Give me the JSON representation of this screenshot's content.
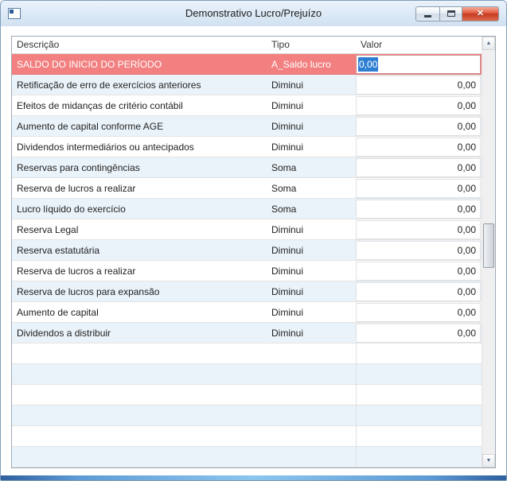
{
  "window": {
    "title": "Demonstrativo Lucro/Prejuízo"
  },
  "icons": {
    "close": "✕",
    "scroll_up": "▲",
    "scroll_down": "▼"
  },
  "colors": {
    "selected_row_bg": "#f28080",
    "selection_bg": "#2e7fd3",
    "alt_row_bg": "#eaf3fa",
    "window_border": "#7f9db9"
  },
  "table": {
    "columns": [
      "Descrição",
      "Tipo",
      "Valor"
    ],
    "empty_row_count": 6,
    "rows": [
      {
        "descricao": "SALDO DO INICIO DO PERÍODO",
        "tipo": "A_Saldo lucro",
        "valor": "0,00",
        "selected": true
      },
      {
        "descricao": "Retificação de erro de exercícios anteriores",
        "tipo": "Diminui",
        "valor": "0,00"
      },
      {
        "descricao": "Efeitos de midanças de critério contábil",
        "tipo": "Diminui",
        "valor": "0,00"
      },
      {
        "descricao": "Aumento de capital conforme AGE",
        "tipo": "Diminui",
        "valor": "0,00"
      },
      {
        "descricao": "Dividendos intermediários ou antecipados",
        "tipo": "Diminui",
        "valor": "0,00"
      },
      {
        "descricao": "Reservas para contingências",
        "tipo": "Soma",
        "valor": "0,00"
      },
      {
        "descricao": "Reserva de lucros a realizar",
        "tipo": "Soma",
        "valor": "0,00"
      },
      {
        "descricao": "Lucro líquido do exercício",
        "tipo": "Soma",
        "valor": "0,00"
      },
      {
        "descricao": "Reserva Legal",
        "tipo": "Diminui",
        "valor": "0,00"
      },
      {
        "descricao": "Reserva estatutária",
        "tipo": "Diminui",
        "valor": "0,00"
      },
      {
        "descricao": "Reserva de lucros a realizar",
        "tipo": "Diminui",
        "valor": "0,00"
      },
      {
        "descricao": "Reserva de lucros para expansão",
        "tipo": "Diminui",
        "valor": "0,00"
      },
      {
        "descricao": "Aumento de capital",
        "tipo": "Diminui",
        "valor": "0,00"
      },
      {
        "descricao": "Dividendos a distribuir",
        "tipo": "Diminui",
        "valor": "0,00"
      }
    ]
  }
}
